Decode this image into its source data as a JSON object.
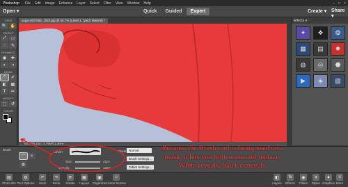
{
  "menubar": {
    "logo": "Photoshop",
    "items": [
      "File",
      "Edit",
      "Image",
      "Enhance",
      "Layer",
      "Select",
      "Filter",
      "View",
      "Window",
      "Help"
    ],
    "winctrl": [
      "–",
      "□",
      "×"
    ]
  },
  "modebar": {
    "open": "Open ▾",
    "modes": [
      "Quick",
      "Guided",
      "Expert"
    ],
    "active_mode": "Expert",
    "create": "Create ▾",
    "share": "Share ▾"
  },
  "toolbar": {
    "sections": [
      "VIEW",
      "SELECT",
      "ENHANCE",
      "DRAW",
      "MODIFY",
      "COLOR"
    ],
    "view_tools": [
      "🔍",
      "✋"
    ],
    "select_tools": [
      "⤢",
      "▭",
      "◌",
      "✎"
    ],
    "enhance_tools": [
      "◉",
      "✚",
      "◐",
      "◑"
    ],
    "draw_tools": [
      "⌒",
      "✐",
      "◧",
      "▩",
      "T",
      "✏"
    ],
    "modify_tools": [
      "⬚",
      "↺"
    ],
    "fg_color": "#000000",
    "bg_color": "#ffffff"
  },
  "document": {
    "tab": "yoga-2087666_1920.jpg @ 66.7% (Level 1, Quick Mask/8) *",
    "status": "66.67%  Doc: 4.79M/11.4M  ▸",
    "mask_color": "#e83a3a"
  },
  "panel": {
    "header": "Effects ▾",
    "effect_icons": [
      "✦",
      "❖",
      "❂",
      "▦",
      "▤",
      "✹",
      "◍",
      "◎",
      "⬣",
      "▶",
      "◈",
      "▧"
    ],
    "effect_colors": [
      "#5a4aa8",
      "#1f1f1f",
      "#3a5a8a",
      "#2a4a7a",
      "#3a3a3a",
      "#c83030",
      "#3a3a3a",
      "#6a6a6a",
      "#5a5a5a",
      "#2a6ac0",
      "#7a8ab0",
      "#3a4a6a"
    ]
  },
  "options": {
    "section_label": "Brush",
    "brush_label": "Brush:",
    "size_label": "Size:",
    "size_value": "41px",
    "opacity_label": "Opacity:",
    "opacity_value": "100%",
    "mode_label": "Mode:",
    "mode_value": "Normal",
    "brush_settings": "Brush Settings...",
    "tablet_settings": "Tablet Settings..."
  },
  "annotation": "Because the Brush tool is being used on a mask, it lets you both erase and replace. White reveals, black conceals.",
  "taskbar": {
    "left": [
      "Photo Bin",
      "Tool Options",
      "Undo",
      "Redo",
      "Rotate",
      "Layout",
      "Organizer",
      "Home Screen"
    ],
    "left_icons": [
      "▤",
      "⚙",
      "↶",
      "↷",
      "⟳",
      "▦",
      "▣",
      "⌂"
    ],
    "right": [
      "Layers",
      "Effects",
      "Filters",
      "Styles",
      "Graphics",
      "More"
    ],
    "right_icons": [
      "◧",
      "fx",
      "◉",
      "✦",
      "▲",
      "≡"
    ]
  }
}
